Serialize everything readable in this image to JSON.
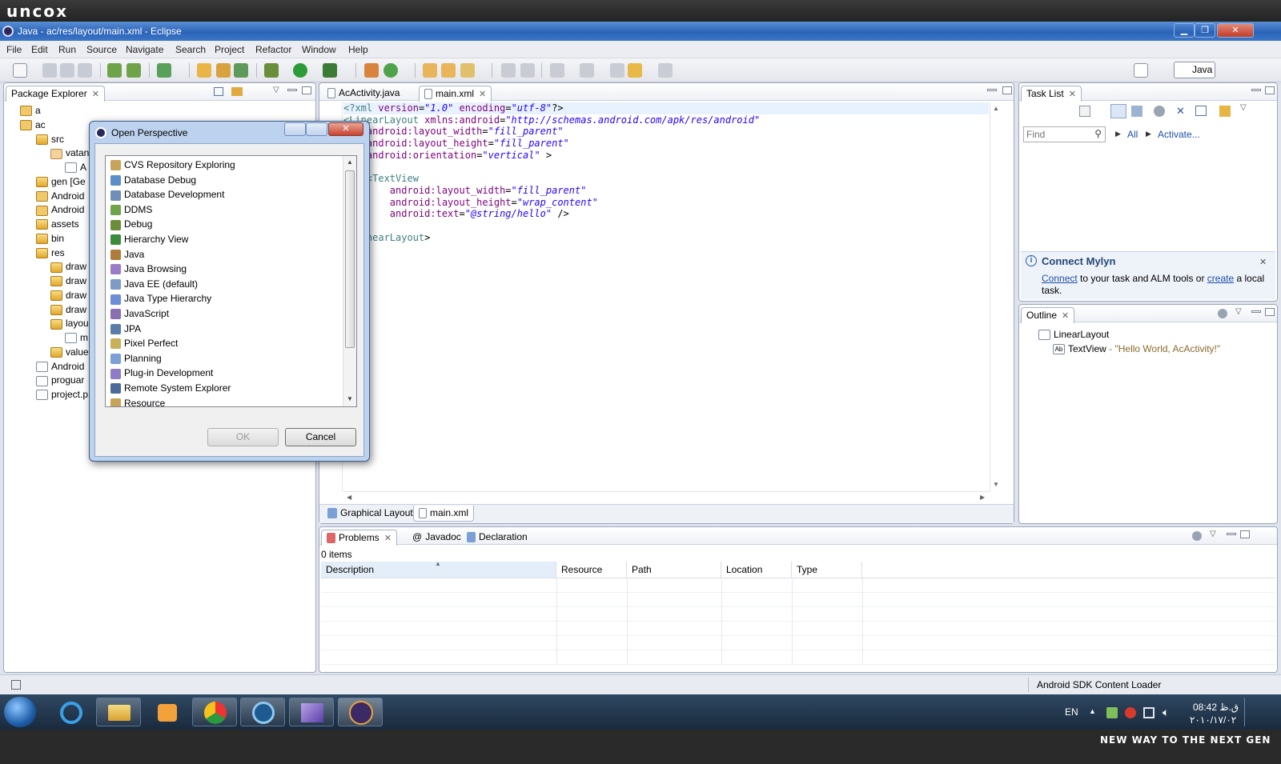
{
  "brand": {
    "logo_text": "uncox",
    "tagline": "NEW WAY TO THE NEXT GEN"
  },
  "window": {
    "title": "Java - ac/res/layout/main.xml - Eclipse",
    "min": "▁",
    "max": "❐",
    "close": "✕"
  },
  "menu": [
    "File",
    "Edit",
    "Run",
    "Source",
    "Navigate",
    "Search",
    "Project",
    "Refactor",
    "Window",
    "Help"
  ],
  "toolbar": {
    "perspective_label": "Java"
  },
  "package_explorer": {
    "title": "Package Explorer",
    "items": [
      {
        "label": "a",
        "icon": "project"
      },
      {
        "label": "ac",
        "icon": "project"
      },
      {
        "label": "src",
        "icon": "folder"
      },
      {
        "label": "vatan",
        "icon": "package"
      },
      {
        "label": "A",
        "icon": "java-file"
      },
      {
        "label": "gen [Ge",
        "icon": "folder"
      },
      {
        "label": "Android",
        "icon": "library"
      },
      {
        "label": "Android",
        "icon": "library"
      },
      {
        "label": "assets",
        "icon": "folder"
      },
      {
        "label": "bin",
        "icon": "folder"
      },
      {
        "label": "res",
        "icon": "folder"
      },
      {
        "label": "draw",
        "icon": "folder"
      },
      {
        "label": "draw",
        "icon": "folder"
      },
      {
        "label": "draw",
        "icon": "folder"
      },
      {
        "label": "draw",
        "icon": "folder"
      },
      {
        "label": "layou",
        "icon": "folder"
      },
      {
        "label": "m",
        "icon": "xml-file"
      },
      {
        "label": "value",
        "icon": "folder"
      },
      {
        "label": "Android",
        "icon": "file"
      },
      {
        "label": "proguar",
        "icon": "file"
      },
      {
        "label": "project.p",
        "icon": "file"
      }
    ]
  },
  "editor": {
    "tabs": [
      {
        "label": "AcActivity.java"
      },
      {
        "label": "main.xml"
      }
    ],
    "bottom_tabs": [
      {
        "label": "Graphical Layout"
      },
      {
        "label": "main.xml"
      }
    ],
    "lines": [
      "<?xml version=\"1.0\" encoding=\"utf-8\"?>",
      "<LinearLayout xmlns:android=\"http://schemas.android.com/apk/res/android\"",
      "    android:layout_width=\"fill_parent\"",
      "    android:layout_height=\"fill_parent\"",
      "    android:orientation=\"vertical\" >",
      "",
      "    <TextView",
      "        android:layout_width=\"fill_parent\"",
      "        android:layout_height=\"wrap_content\"",
      "        android:text=\"@string/hello\" />",
      "",
      "</LinearLayout>"
    ]
  },
  "task_list": {
    "title": "Task List",
    "find_placeholder": "Find",
    "all_label": "All",
    "activate_label": "Activate...",
    "mylyn_title": "Connect Mylyn",
    "mylyn_connect": "Connect",
    "mylyn_text1": " to your task and ALM tools or ",
    "mylyn_create": "create",
    "mylyn_text2": " a local task."
  },
  "outline": {
    "title": "Outline",
    "root": "LinearLayout",
    "child": "TextView",
    "child_detail": " - \"Hello World, AcActivity!\""
  },
  "problems": {
    "tabs": [
      {
        "label": "Problems"
      },
      {
        "label": "Javadoc"
      },
      {
        "label": "Declaration"
      }
    ],
    "count": "0 items",
    "columns": [
      "Description",
      "Resource",
      "Path",
      "Location",
      "Type"
    ]
  },
  "dialog": {
    "title": "Open Perspective",
    "items": [
      "CVS Repository Exploring",
      "Database Debug",
      "Database Development",
      "DDMS",
      "Debug",
      "Hierarchy View",
      "Java",
      "Java Browsing",
      "Java EE (default)",
      "Java Type Hierarchy",
      "JavaScript",
      "JPA",
      "Pixel Perfect",
      "Planning",
      "Plug-in Development",
      "Remote System Explorer",
      "Resource"
    ],
    "ok_label": "OK",
    "cancel_label": "Cancel"
  },
  "status": {
    "loader": "Android SDK Content Loader"
  },
  "taskbar": {
    "lang": "EN",
    "time": "08:42 ق.ظ",
    "date": "۲۰۱۰/۱۷/۰۲",
    "pinned": [
      "windows-start",
      "internet-explorer",
      "file-explorer",
      "media-player",
      "chrome",
      "browser",
      "visual-studio",
      "java-ee-ide"
    ]
  }
}
